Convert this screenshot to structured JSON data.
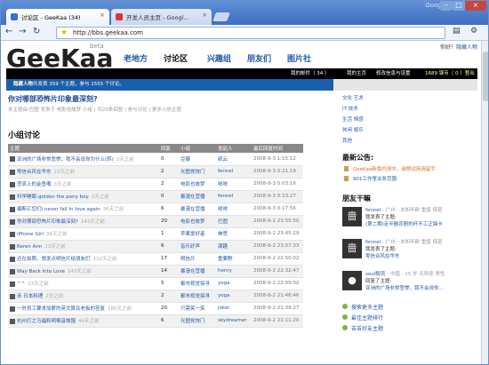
{
  "browser": {
    "tabs": [
      {
        "title": "讨论区 - GeeKaa (34)"
      },
      {
        "title": "开发人员主页 - Googl..."
      }
    ],
    "brand": "Google",
    "url": "http://bbs.geekaa.com"
  },
  "site": {
    "logo": "GeeKaa",
    "beta": "beta",
    "nav": [
      "老地方",
      "讨论区",
      "兴趣组",
      "朋友们",
      "图片社"
    ],
    "user": "你好！",
    "user_link": "隐藏人物",
    "bar": {
      "mail": "我的邮件（ 34 ）",
      "home": "我的主页",
      "edit": "修改信息与设置",
      "points": "1689 钢币（ 0 ）登出"
    },
    "welcome": {
      "name": "隐藏人物",
      "text": "共发表 359 个主题，参与 1555 个讨论。"
    }
  },
  "topic": {
    "title": "你对哪部恐怖片印象最深刻?",
    "meta": "本主题由 巴图 发表于 电影也故梦 小组 | 共20条回复 | 参与讨论 | 更多火热主题"
  },
  "group_discussion": {
    "heading": "小组讨论",
    "headers": [
      "主题",
      "回复",
      "小组",
      "发起人",
      "最后回复时间"
    ],
    "rows": [
      [
        "亚洲的广场非常悲惨，我不会说你为什么(转)",
        "2天之前",
        "0",
        "豆瓣",
        "纸云",
        "2008-9-3 1:15:12"
      ],
      [
        "零信合风在华东",
        "22天之前",
        "2",
        "光图党快门",
        "fennel",
        "2008-9-3 0:21:19"
      ],
      [
        "悲哀上的金鱼嘴",
        "3天之前",
        "2",
        "电影也故梦",
        "哞哞",
        "2008-9-3 0:03:16"
      ],
      [
        "科学睡眠-golden the pony boy",
        "2天之前",
        "0",
        "暴漫在营播",
        "fennel",
        "2008-9-3 0:13:27"
      ],
      [
        "编斯汇您们I never fall in love again",
        "36天之前",
        "6",
        "暴漫在营播",
        "哞哞",
        "2008-9-3 0:17:56"
      ],
      [
        "你对哪部恐怖片印象最深刻?",
        "143天之前",
        "20",
        "电影也故梦",
        "巴图",
        "2008-9-2 23:55:50"
      ],
      [
        "iPhone Girl",
        "36天之前",
        "1",
        "苹果爱好者",
        "神思",
        "2008-9-2 23:45:29"
      ],
      [
        "Keren Ann",
        "23天之前",
        "6",
        "音乐好声",
        "潮趣",
        "2008-9-2 23:07:33"
      ],
      [
        "还在拍照，想发点明信片给朋友们",
        "132天之前",
        "17",
        "明信片",
        "重要野",
        "2008-9-2 22:50:02"
      ],
      [
        "Way Back Into Love",
        "243天之前",
        "14",
        "暴漫在营播",
        "henry",
        "2008-9-2 22:32:47"
      ],
      [
        "^^",
        "23天之前",
        "5",
        "都市视觉探寻",
        "yoga",
        "2008-9-2 22:09:02"
      ],
      [
        "赤 日本料理",
        "2天之前",
        "2",
        "都市视觉探寻",
        "yoga",
        "2008-9-2 21:46:46"
      ],
      [
        "一时员工要求加薪的英文算及老板的答复",
        "180天之前",
        "20",
        "只需笑一笑",
        "joker",
        "2008-9-2 21:39:27"
      ],
      [
        "杭州打之马福和明霉音故围",
        "44天之前",
        "6",
        "光图党快门",
        "skydreamer",
        "2008-9-2 21:11:20"
      ]
    ]
  },
  "sidebar": {
    "cats": [
      "文化 艺术",
      "IT 技术",
      "生活 情感",
      "休闲 娱乐",
      "其他"
    ],
    "notice_heading": "最新公告:",
    "notices": [
      "GeeKaa新版内测中，诚想试用请留手",
      "901工作室业务范围"
    ],
    "friends_heading": "朋友干嘛",
    "friends": [
      {
        "avatar": "啬",
        "name": "fennel",
        "loc": "- 广州",
        "action": "- 未知年龄 重星 保密",
        "l2": "我发表了主题:",
        "l3": "(第二期)走半散农剧的纤不工正锋卡"
      },
      {
        "avatar": "啬",
        "name": "fennel",
        "loc": "- 广州",
        "action": "- 未知年龄 重星 保密",
        "l2": "我发表了主题:",
        "l3": "零信合风在华东"
      },
      {
        "avatar": "●",
        "name": "soul聊流",
        "loc": "- 中国",
        "action": "- 25 岁 天秤座 男性",
        "l2": "回复了主题:",
        "l3": "亚洲的广场非常悲惨，我不会说你..."
      }
    ],
    "links": [
      "搜索更多主题",
      "最佳主题排行",
      "苦苦好友主题"
    ]
  }
}
